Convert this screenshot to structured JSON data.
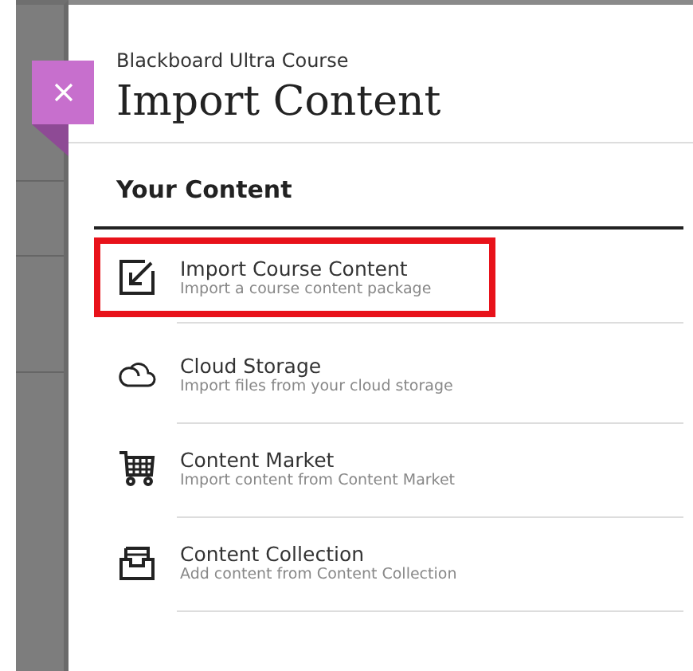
{
  "header": {
    "breadcrumb": "Blackboard Ultra Course",
    "title": "Import Content"
  },
  "section": {
    "title": "Your Content"
  },
  "items": [
    {
      "kind": "import",
      "title": "Import Course Content",
      "description": "Import a course content package",
      "highlighted": true
    },
    {
      "kind": "cloud",
      "title": "Cloud Storage",
      "description": "Import files from your cloud storage",
      "highlighted": false
    },
    {
      "kind": "market",
      "title": "Content Market",
      "description": "Import content from Content Market",
      "highlighted": false
    },
    {
      "kind": "collection",
      "title": "Content Collection",
      "description": "Add content from Content Collection",
      "highlighted": false
    }
  ]
}
